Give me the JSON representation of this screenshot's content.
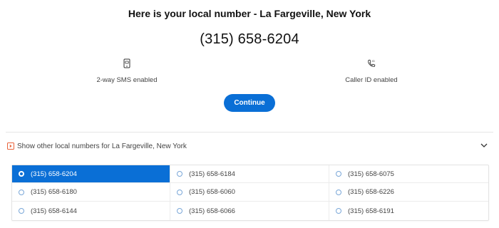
{
  "header": {
    "title": "Here is your local number - La Fargeville, New York",
    "phone_number": "(315) 658-6204"
  },
  "features": [
    {
      "icon": "sms-phone-icon",
      "label": "2-way SMS enabled"
    },
    {
      "icon": "caller-id-icon",
      "label": "Caller ID enabled"
    }
  ],
  "continue_label": "Continue",
  "other_numbers": {
    "toggle_label": "Show other local numbers for La Fargeville, New York",
    "selected_index": 0,
    "numbers": [
      "(315) 658-6204",
      "(315) 658-6184",
      "(315) 658-6075",
      "(315) 658-6180",
      "(315) 658-6060",
      "(315) 658-6226",
      "(315) 658-6144",
      "(315) 658-6066",
      "(315) 658-6191"
    ]
  },
  "colors": {
    "accent": "#0a6fd6",
    "expand_icon": "#e8623a"
  }
}
